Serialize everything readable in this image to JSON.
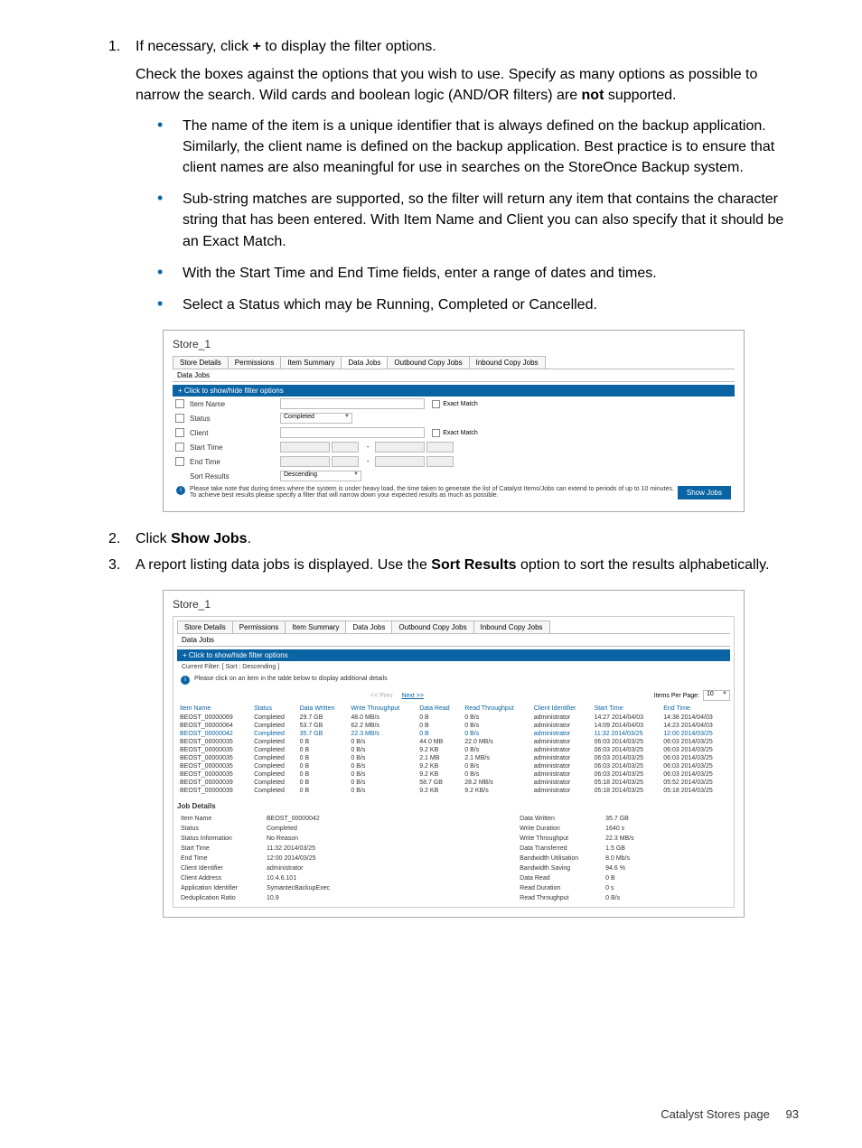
{
  "steps": {
    "s1": {
      "num": "1.",
      "text1a": "If necessary, click ",
      "plus": "+",
      "text1b": " to display the filter options.",
      "text2a": "Check the boxes against the options that you wish to use. Specify as many options as possible to narrow the search. Wild cards and boolean logic (AND/OR filters) are ",
      "not": "not",
      "text2b": " supported.",
      "b1": "The name of the item is a unique identifier that is always defined on the backup application. Similarly, the client name is defined on the backup application. Best practice is to ensure that client names are also meaningful for use in searches on the StoreOnce Backup system.",
      "b2": "Sub-string matches are supported, so the filter will return any item that contains the character string that has been entered. With Item Name and Client you can also specify that it should be an Exact Match.",
      "b3": "With the Start Time and End Time fields, enter a range of dates and times.",
      "b4": "Select a Status which may be Running, Completed or Cancelled."
    },
    "s2": {
      "num": "2.",
      "text_a": "Click ",
      "bold": "Show Jobs",
      "text_b": "."
    },
    "s3": {
      "num": "3.",
      "text_a": "A report listing data jobs is displayed. Use the ",
      "bold": "Sort Results",
      "text_b": " option to sort the results alphabetically."
    }
  },
  "win1": {
    "title": "Store_1",
    "tabs": [
      "Store Details",
      "Permissions",
      "Item Summary",
      "Data Jobs",
      "Outbound Copy Jobs",
      "Inbound Copy Jobs"
    ],
    "active_tab": 3,
    "subtab": "Data Jobs",
    "bluebar": "+ Click to show/hide filter options",
    "rows": {
      "itemname": "Item Name",
      "status": "Status",
      "client": "Client",
      "starttime": "Start Time",
      "endtime": "End Time",
      "sortresults": "Sort Results"
    },
    "status_val": "Completed",
    "sort_val": "Descending",
    "exact": "Exact Match",
    "note": "Please take note that during times where the system is under heavy load, the time taken to generate the list of Catalyst Items/Jobs can extend to periods of up to 10 minutes. To achieve best results please specify a filter that will narrow down your expected results as much as possible.",
    "showjobs": "Show Jobs"
  },
  "win2": {
    "title": "Store_1",
    "bluebar": "+ Click to show/hide filter options",
    "filter": "Current Filter: [ Sort : Descending ]",
    "clickmsg": "Please click on an item in the table below to display additional details",
    "prev": "<< Prev",
    "next": "Next >>",
    "ipp_label": "Items Per Page:",
    "ipp_val": "10",
    "headers": [
      "Item Name",
      "Status",
      "Data Written",
      "Write Throughput",
      "Data Read",
      "Read Throughput",
      "Client Identifier",
      "Start Time",
      "End Time"
    ],
    "rows": [
      [
        "BEOST_00000069",
        "Completed",
        "29.7 GB",
        "48.0 MB/s",
        "0 B",
        "0 B/s",
        "administrator",
        "14:27 2014/04/03",
        "14:38 2014/04/03"
      ],
      [
        "BEOST_00000064",
        "Completed",
        "53.7 GB",
        "62.2 MB/s",
        "0 B",
        "0 B/s",
        "administrator",
        "14:09 2014/04/03",
        "14:23 2014/04/03"
      ],
      [
        "BEOST_00000042",
        "Completed",
        "35.7 GB",
        "22.3 MB/s",
        "0 B",
        "0 B/s",
        "administrator",
        "11:32 2014/03/25",
        "12:00 2014/03/25"
      ],
      [
        "BEOST_00000035",
        "Completed",
        "0 B",
        "0 B/s",
        "44.0 MB",
        "22.0 MB/s",
        "administrator",
        "06:03 2014/03/25",
        "06:03 2014/03/25"
      ],
      [
        "BEOST_00000035",
        "Completed",
        "0 B",
        "0 B/s",
        "9.2 KB",
        "0 B/s",
        "administrator",
        "06:03 2014/03/25",
        "06:03 2014/03/25"
      ],
      [
        "BEOST_00000035",
        "Completed",
        "0 B",
        "0 B/s",
        "2.1 MB",
        "2.1 MB/s",
        "administrator",
        "06:03 2014/03/25",
        "06:03 2014/03/25"
      ],
      [
        "BEOST_00000035",
        "Completed",
        "0 B",
        "0 B/s",
        "9.2 KB",
        "0 B/s",
        "administrator",
        "06:03 2014/03/25",
        "06:03 2014/03/25"
      ],
      [
        "BEOST_00000035",
        "Completed",
        "0 B",
        "0 B/s",
        "9.2 KB",
        "0 B/s",
        "administrator",
        "06:03 2014/03/25",
        "06:03 2014/03/25"
      ],
      [
        "BEOST_00000039",
        "Completed",
        "0 B",
        "0 B/s",
        "58.7 GB",
        "28.2 MB/s",
        "administrator",
        "05:18 2014/03/25",
        "05:52 2014/03/25"
      ],
      [
        "BEOST_00000039",
        "Completed",
        "0 B",
        "0 B/s",
        "9.2 KB",
        "9.2 KB/s",
        "administrator",
        "05:18 2014/03/25",
        "05:18 2014/03/25"
      ]
    ],
    "sel_row": 2,
    "details_title": "Job Details",
    "details_left": [
      [
        "Item Name",
        "BEOST_00000042"
      ],
      [
        "Status",
        "Completed"
      ],
      [
        "Status Information",
        "No Reason"
      ],
      [
        "Start Time",
        "11:32 2014/03/25"
      ],
      [
        "End Time",
        "12:00 2014/03/25"
      ],
      [
        "Client Identifier",
        "administrator"
      ],
      [
        "Client Address",
        "10.4.6.101"
      ],
      [
        "Application Identifier",
        "SymantecBackupExec"
      ],
      [
        "Deduplication Ratio",
        "10.9"
      ]
    ],
    "details_right": [
      [
        "Data Written",
        "35.7 GB"
      ],
      [
        "Write Duration",
        "1640 s"
      ],
      [
        "Write Throughput",
        "22.3 MB/s"
      ],
      [
        "Data Transferred",
        "1.5 GB"
      ],
      [
        "Bandwidth Utilisation",
        "8.0 Mb/s"
      ],
      [
        "Bandwidth Saving",
        "94.6 %"
      ],
      [
        "Data Read",
        "0 B"
      ],
      [
        "Read Duration",
        "0 s"
      ],
      [
        "Read Throughput",
        "0 B/s"
      ]
    ]
  },
  "footer": {
    "label": "Catalyst Stores page",
    "num": "93"
  }
}
